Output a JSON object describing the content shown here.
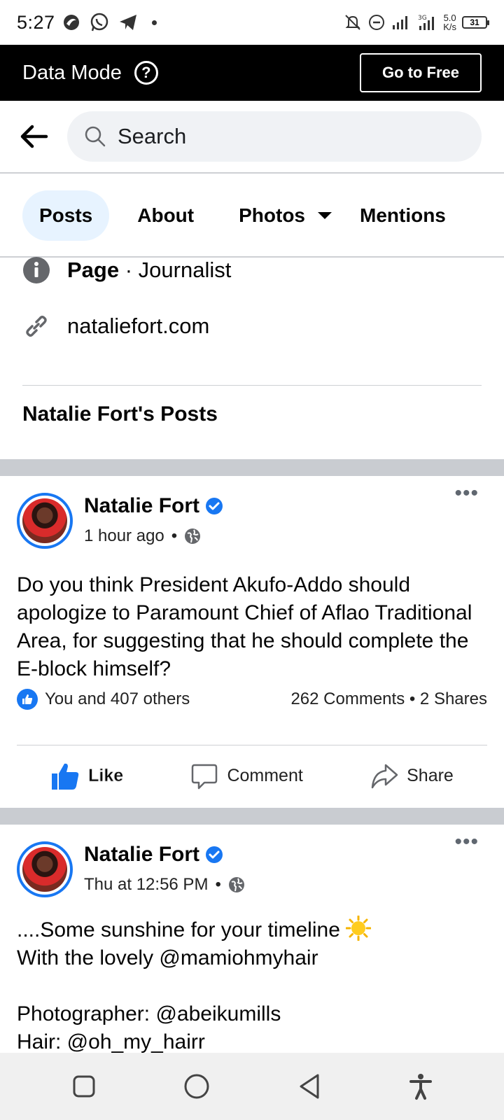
{
  "status_bar": {
    "time": "5:27",
    "net_speed_value": "5.0",
    "net_speed_unit": "K/s",
    "battery": "31"
  },
  "data_banner": {
    "title": "Data Mode",
    "button_label": "Go to Free"
  },
  "search": {
    "placeholder": "Search"
  },
  "tabs": [
    {
      "label": "Posts",
      "active": true
    },
    {
      "label": "About",
      "active": false
    },
    {
      "label": "Photos",
      "active": false
    },
    {
      "label": "Mentions",
      "active": false
    }
  ],
  "page_info": {
    "category_bold": "Page",
    "category_rest": " · Journalist",
    "website": "nataliefort.com"
  },
  "posts_section_title": "Natalie Fort's Posts",
  "posts": [
    {
      "author": "Natalie Fort",
      "time": "1 hour ago",
      "body": "Do you think President Akufo-Addo should apologize to Paramount Chief of Aflao Traditional Area, for suggesting that he should complete the E-block himself?",
      "reactions": "You and 407 others",
      "comments_shares": "262 Comments • 2 Shares",
      "like_label": "Like",
      "comment_label": "Comment",
      "share_label": "Share"
    },
    {
      "author": "Natalie Fort",
      "time": "Thu at 12:56 PM",
      "body_line1": "....Some sunshine for your timeline",
      "body_line2": "With the lovely @mamiohmyhair",
      "body_line3": "Photographer: @abeikumills",
      "body_line4": "Hair: @oh_my_hairr"
    }
  ],
  "colors": {
    "accent": "#1877f2",
    "banner_bg": "#000000",
    "separator": "#c9ccd1"
  }
}
